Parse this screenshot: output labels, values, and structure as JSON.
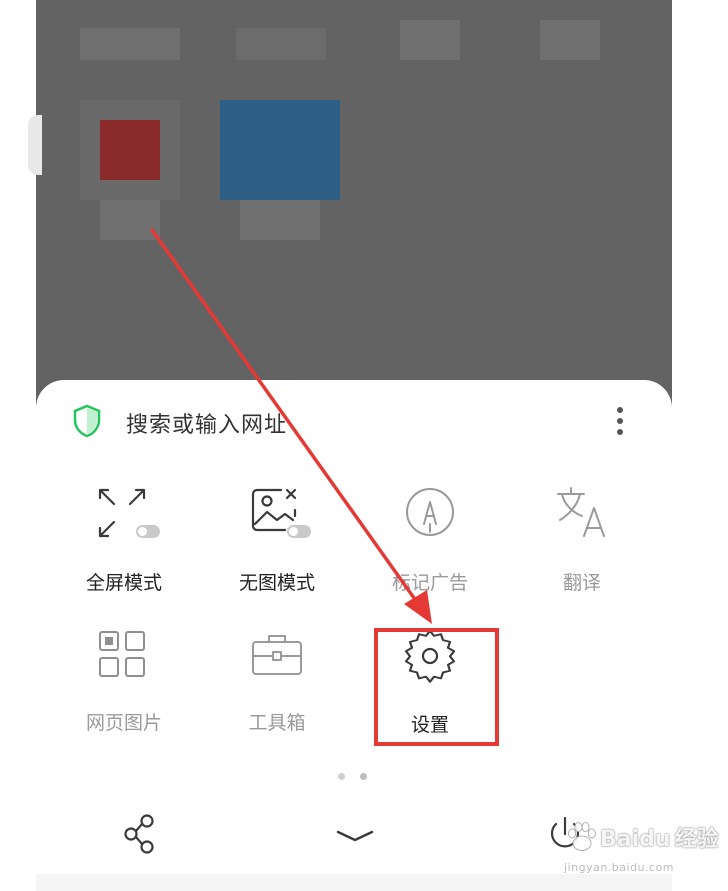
{
  "search": {
    "placeholder": "搜索或输入网址"
  },
  "menu": {
    "row1": [
      {
        "label": "全屏模式",
        "icon": "fullscreen-icon",
        "state": "off"
      },
      {
        "label": "无图模式",
        "icon": "no-image-icon",
        "state": "off"
      },
      {
        "label": "标记广告",
        "icon": "mark-ad-icon"
      },
      {
        "label": "翻译",
        "icon": "translate-icon"
      }
    ],
    "row2": [
      {
        "label": "网页图片",
        "icon": "page-images-icon"
      },
      {
        "label": "工具箱",
        "icon": "toolbox-icon"
      },
      {
        "label": "设置",
        "icon": "settings-gear-icon"
      }
    ]
  },
  "pager": {
    "pages": 2,
    "current": 2
  },
  "bottom_nav": [
    {
      "icon": "share-icon"
    },
    {
      "icon": "chevron-down-icon"
    },
    {
      "icon": "power-icon"
    }
  ],
  "annotation": {
    "highlight_color": "#e53935",
    "target": "设置"
  },
  "watermark": {
    "brand": "Baidu",
    "text": "经验",
    "url": "jingyan.baidu.com"
  },
  "colors": {
    "overlay": "#636363",
    "shield": "#22c55e",
    "label_dark": "#222222",
    "label_grey": "#9a9a9a"
  }
}
